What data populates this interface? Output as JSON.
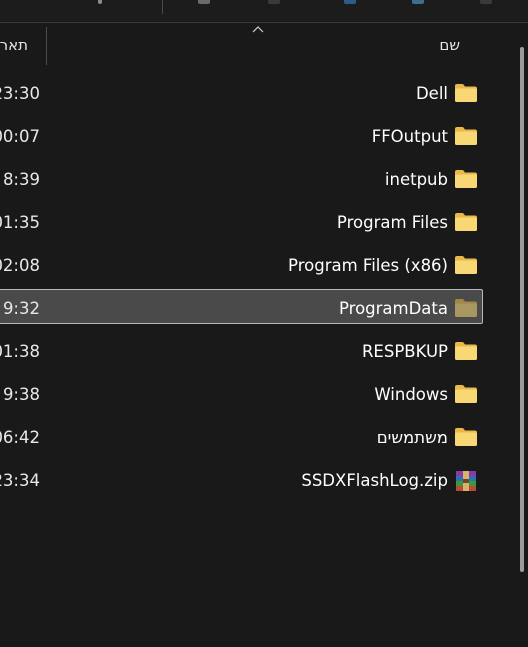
{
  "header": {
    "name_label": "שם",
    "date_label": "תאריך"
  },
  "files": [
    {
      "name": "Dell",
      "date": "23:30",
      "type": "folder",
      "icon": "folder-icon"
    },
    {
      "name": "FFOutput",
      "date": "00:07",
      "type": "folder",
      "icon": "folder-icon"
    },
    {
      "name": "inetpub",
      "date": "8:39",
      "type": "folder",
      "icon": "folder-icon"
    },
    {
      "name": "Program Files",
      "date": "01:35",
      "type": "folder",
      "icon": "folder-icon"
    },
    {
      "name": "Program Files (x86)",
      "date": "02:08",
      "type": "folder",
      "icon": "folder-icon"
    },
    {
      "name": "ProgramData",
      "date": "9:32",
      "type": "folder",
      "icon": "folder-icon",
      "selected": true
    },
    {
      "name": "RESPBKUP",
      "date": "01:38",
      "type": "folder",
      "icon": "folder-icon"
    },
    {
      "name": "Windows",
      "date": "9:38",
      "type": "folder",
      "icon": "folder-icon"
    },
    {
      "name": "משתמשים",
      "date": "06:42",
      "type": "folder",
      "icon": "folder-icon"
    },
    {
      "name": "SSDXFlashLog.zip",
      "date": "23:34",
      "type": "zip",
      "icon": "winrar-archive-icon"
    }
  ],
  "colors": {
    "background": "#191919",
    "folder": "#f8d775",
    "folder_dark": "#e8b84a",
    "selected_bg": "#4a4a4a",
    "selected_border": "#b8b8b8"
  }
}
